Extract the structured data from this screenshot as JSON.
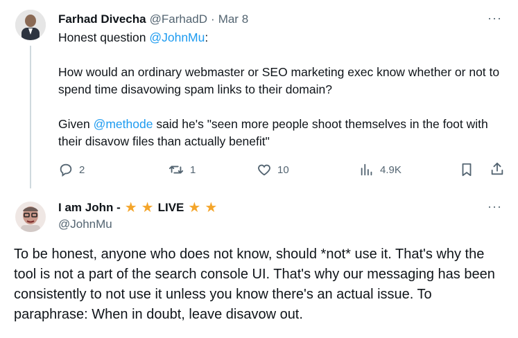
{
  "tweet1": {
    "author_name": "Farhad Divecha",
    "handle": "@FarhadD",
    "separator": "·",
    "date": "Mar 8",
    "text_intro": "Honest question ",
    "mention_1": "@JohnMu",
    "text_intro_end": ":",
    "paragraph_2": "How would an ordinary webmaster or SEO marketing exec know whether or not to spend time disavowing spam links to their domain?",
    "p3_start": "Given ",
    "mention_2": "@methode",
    "p3_end": " said he's \"seen more people shoot themselves in the foot with their disavow files than actually benefit\"",
    "replies": "2",
    "reposts": "1",
    "likes": "10",
    "views": "4.9K",
    "more": "···"
  },
  "tweet2": {
    "author_name": "I am John -",
    "name_live": "LIVE",
    "handle": "@JohnMu",
    "more": "···",
    "text": "To be honest, anyone who does not know, should *not* use it. That's why the tool is not a part of the search console UI. That's why our messaging has been consistently to not use it unless you know there's an actual issue. To paraphrase: When in doubt, leave disavow out."
  },
  "colors": {
    "link": "#1d9bf0",
    "muted": "#536471",
    "star": "#f4a52a",
    "thread_line": "#cfd9de"
  },
  "icons": [
    "reply-icon",
    "repost-icon",
    "like-icon",
    "views-icon",
    "bookmark-icon",
    "share-icon",
    "star-icon",
    "more-icon"
  ]
}
